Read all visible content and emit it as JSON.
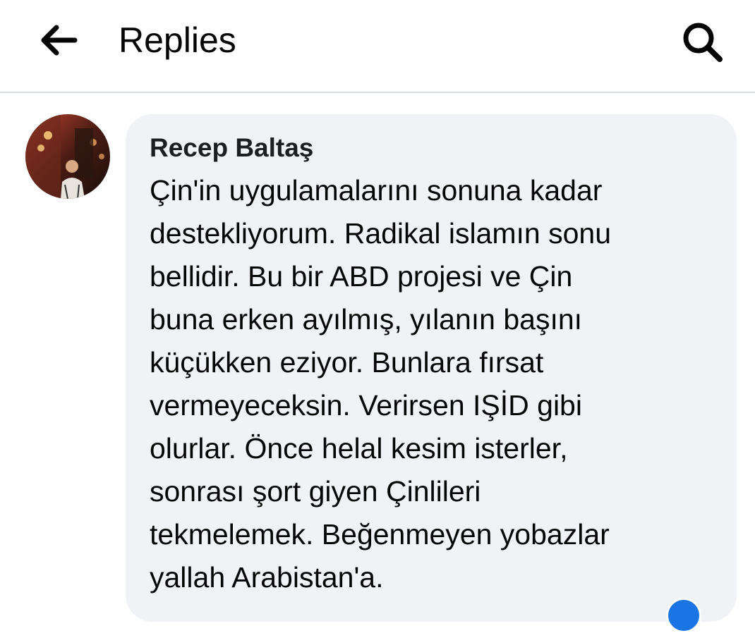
{
  "header": {
    "title": "Replies",
    "back_icon": "arrow-left-icon",
    "search_icon": "search-icon"
  },
  "comment": {
    "author": "Recep Baltaş",
    "text": "Çin'in uygulamalarını sonuna kadar\ndestekliyorum. Radikal islamın sonu\nbellidir. Bu bir ABD projesi ve Çin\nbuna erken ayılmış, yılanın başını\nküçükken eziyor. Bunlara fırsat\nvermeyeceksin. Verirsen IŞİD gibi\nolurlar. Önce helal kesim isterler,\nsonrası şort giyen Çinlileri\ntekmelemek. Beğenmeyen yobazlar\nyallah Arabistan'a."
  },
  "colors": {
    "bubble": "#f0f2f5",
    "divider": "#dadde1",
    "reaction": "#1b74e4"
  }
}
